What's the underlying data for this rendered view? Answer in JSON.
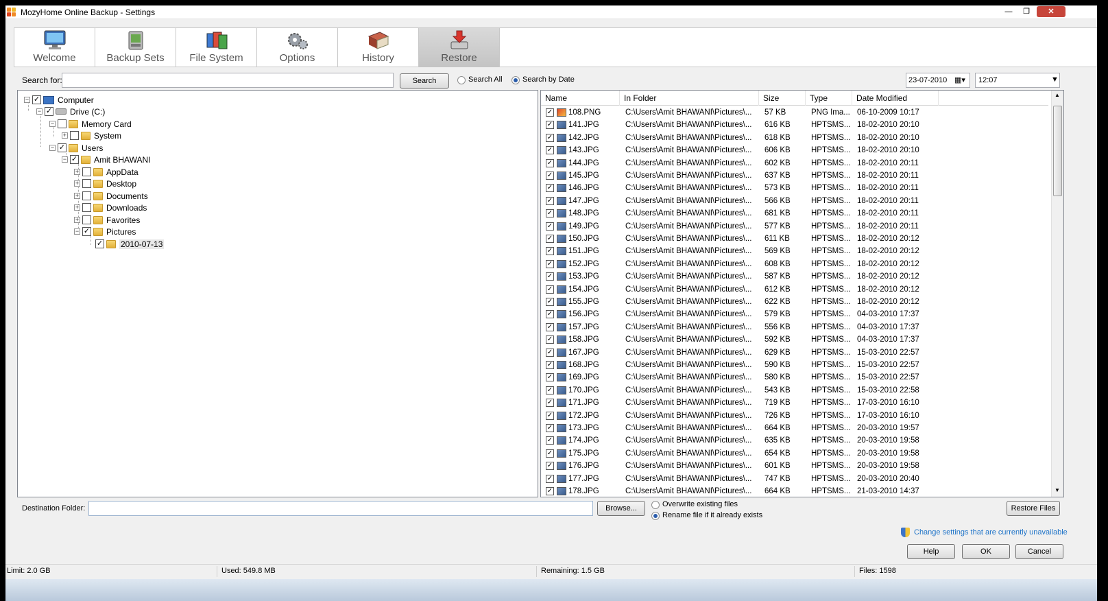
{
  "window": {
    "title": "MozyHome Online Backup - Settings"
  },
  "tabs": [
    {
      "label": "Welcome",
      "icon": "monitor-icon"
    },
    {
      "label": "Backup Sets",
      "icon": "backup-sets-icon"
    },
    {
      "label": "File System",
      "icon": "file-system-icon"
    },
    {
      "label": "Options",
      "icon": "gears-icon"
    },
    {
      "label": "History",
      "icon": "book-icon"
    },
    {
      "label": "Restore",
      "icon": "restore-icon",
      "active": true
    }
  ],
  "search": {
    "label": "Search for:",
    "value": "",
    "button": "Search",
    "radio_all": "Search All",
    "radio_date": "Search by Date",
    "selected": "Search by Date",
    "date": "23-07-2010",
    "time": "12:07"
  },
  "tree": [
    {
      "label": "Computer"
    },
    {
      "label": "Drive (C:)"
    },
    {
      "label": "Memory Card"
    },
    {
      "label": "System"
    },
    {
      "label": "Users"
    },
    {
      "label": "Amit BHAWANI"
    },
    {
      "label": "AppData"
    },
    {
      "label": "Desktop"
    },
    {
      "label": "Documents"
    },
    {
      "label": "Downloads"
    },
    {
      "label": "Favorites"
    },
    {
      "label": "Pictures"
    },
    {
      "label": "2010-07-13"
    }
  ],
  "file_list": {
    "columns": [
      "Name",
      "In Folder",
      "Size",
      "Type",
      "Date Modified"
    ],
    "rows": [
      [
        "108.PNG",
        "C:\\Users\\Amit BHAWANI\\Pictures\\...",
        "57 KB",
        "PNG Ima...",
        "06-10-2009 10:17"
      ],
      [
        "141.JPG",
        "C:\\Users\\Amit BHAWANI\\Pictures\\...",
        "616 KB",
        "HPTSMS...",
        "18-02-2010 20:10"
      ],
      [
        "142.JPG",
        "C:\\Users\\Amit BHAWANI\\Pictures\\...",
        "618 KB",
        "HPTSMS...",
        "18-02-2010 20:10"
      ],
      [
        "143.JPG",
        "C:\\Users\\Amit BHAWANI\\Pictures\\...",
        "606 KB",
        "HPTSMS...",
        "18-02-2010 20:10"
      ],
      [
        "144.JPG",
        "C:\\Users\\Amit BHAWANI\\Pictures\\...",
        "602 KB",
        "HPTSMS...",
        "18-02-2010 20:11"
      ],
      [
        "145.JPG",
        "C:\\Users\\Amit BHAWANI\\Pictures\\...",
        "637 KB",
        "HPTSMS...",
        "18-02-2010 20:11"
      ],
      [
        "146.JPG",
        "C:\\Users\\Amit BHAWANI\\Pictures\\...",
        "573 KB",
        "HPTSMS...",
        "18-02-2010 20:11"
      ],
      [
        "147.JPG",
        "C:\\Users\\Amit BHAWANI\\Pictures\\...",
        "566 KB",
        "HPTSMS...",
        "18-02-2010 20:11"
      ],
      [
        "148.JPG",
        "C:\\Users\\Amit BHAWANI\\Pictures\\...",
        "681 KB",
        "HPTSMS...",
        "18-02-2010 20:11"
      ],
      [
        "149.JPG",
        "C:\\Users\\Amit BHAWANI\\Pictures\\...",
        "577 KB",
        "HPTSMS...",
        "18-02-2010 20:11"
      ],
      [
        "150.JPG",
        "C:\\Users\\Amit BHAWANI\\Pictures\\...",
        "611 KB",
        "HPTSMS...",
        "18-02-2010 20:12"
      ],
      [
        "151.JPG",
        "C:\\Users\\Amit BHAWANI\\Pictures\\...",
        "569 KB",
        "HPTSMS...",
        "18-02-2010 20:12"
      ],
      [
        "152.JPG",
        "C:\\Users\\Amit BHAWANI\\Pictures\\...",
        "608 KB",
        "HPTSMS...",
        "18-02-2010 20:12"
      ],
      [
        "153.JPG",
        "C:\\Users\\Amit BHAWANI\\Pictures\\...",
        "587 KB",
        "HPTSMS...",
        "18-02-2010 20:12"
      ],
      [
        "154.JPG",
        "C:\\Users\\Amit BHAWANI\\Pictures\\...",
        "612 KB",
        "HPTSMS...",
        "18-02-2010 20:12"
      ],
      [
        "155.JPG",
        "C:\\Users\\Amit BHAWANI\\Pictures\\...",
        "622 KB",
        "HPTSMS...",
        "18-02-2010 20:12"
      ],
      [
        "156.JPG",
        "C:\\Users\\Amit BHAWANI\\Pictures\\...",
        "579 KB",
        "HPTSMS...",
        "04-03-2010 17:37"
      ],
      [
        "157.JPG",
        "C:\\Users\\Amit BHAWANI\\Pictures\\...",
        "556 KB",
        "HPTSMS...",
        "04-03-2010 17:37"
      ],
      [
        "158.JPG",
        "C:\\Users\\Amit BHAWANI\\Pictures\\...",
        "592 KB",
        "HPTSMS...",
        "04-03-2010 17:37"
      ],
      [
        "167.JPG",
        "C:\\Users\\Amit BHAWANI\\Pictures\\...",
        "629 KB",
        "HPTSMS...",
        "15-03-2010 22:57"
      ],
      [
        "168.JPG",
        "C:\\Users\\Amit BHAWANI\\Pictures\\...",
        "590 KB",
        "HPTSMS...",
        "15-03-2010 22:57"
      ],
      [
        "169.JPG",
        "C:\\Users\\Amit BHAWANI\\Pictures\\...",
        "580 KB",
        "HPTSMS...",
        "15-03-2010 22:57"
      ],
      [
        "170.JPG",
        "C:\\Users\\Amit BHAWANI\\Pictures\\...",
        "543 KB",
        "HPTSMS...",
        "15-03-2010 22:58"
      ],
      [
        "171.JPG",
        "C:\\Users\\Amit BHAWANI\\Pictures\\...",
        "719 KB",
        "HPTSMS...",
        "17-03-2010 16:10"
      ],
      [
        "172.JPG",
        "C:\\Users\\Amit BHAWANI\\Pictures\\...",
        "726 KB",
        "HPTSMS...",
        "17-03-2010 16:10"
      ],
      [
        "173.JPG",
        "C:\\Users\\Amit BHAWANI\\Pictures\\...",
        "664 KB",
        "HPTSMS...",
        "20-03-2010 19:57"
      ],
      [
        "174.JPG",
        "C:\\Users\\Amit BHAWANI\\Pictures\\...",
        "635 KB",
        "HPTSMS...",
        "20-03-2010 19:58"
      ],
      [
        "175.JPG",
        "C:\\Users\\Amit BHAWANI\\Pictures\\...",
        "654 KB",
        "HPTSMS...",
        "20-03-2010 19:58"
      ],
      [
        "176.JPG",
        "C:\\Users\\Amit BHAWANI\\Pictures\\...",
        "601 KB",
        "HPTSMS...",
        "20-03-2010 19:58"
      ],
      [
        "177.JPG",
        "C:\\Users\\Amit BHAWANI\\Pictures\\...",
        "747 KB",
        "HPTSMS...",
        "20-03-2010 20:40"
      ],
      [
        "178.JPG",
        "C:\\Users\\Amit BHAWANI\\Pictures\\...",
        "664 KB",
        "HPTSMS...",
        "21-03-2010 14:37"
      ]
    ]
  },
  "destination": {
    "label": "Destination Folder:",
    "value": "",
    "browse": "Browse...",
    "overwrite": "Overwrite existing files",
    "rename": "Rename file if it already exists",
    "restore": "Restore Files"
  },
  "footer": {
    "change_settings": "Change settings that are currently unavailable",
    "help": "Help",
    "ok": "OK",
    "cancel": "Cancel"
  },
  "status": {
    "limit": "Limit: 2.0 GB",
    "used": "Used: 549.8 MB",
    "remaining": "Remaining: 1.5 GB",
    "files": "Files: 1598"
  },
  "colors": {
    "accent": "#2a5caa",
    "link": "#1e73c8"
  }
}
